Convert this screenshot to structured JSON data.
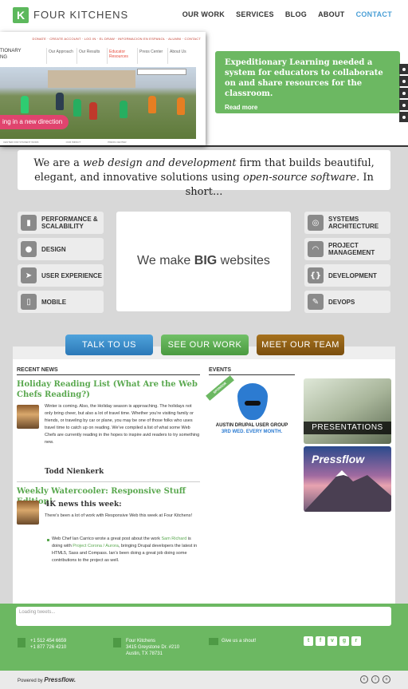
{
  "header": {
    "logo_letter": "K",
    "logo_text": "FOUR KITCHENS",
    "nav": [
      "OUR WORK",
      "SERVICES",
      "BLOG",
      "ABOUT",
      "CONTACT"
    ]
  },
  "hero": {
    "shot_toplinks": "DONATE · CREATE ACCOUNT · LOG IN · EL DRAW · INFORMACION EN ESPANOL · ALUMNI · CONTACT",
    "shot_logo": "TIONARY\nNG",
    "shot_nav": [
      "Our Approach",
      "Our Results",
      "Educator Resources",
      "Press Center",
      "About Us"
    ],
    "shot_banner": "ing in a new direction",
    "shot_foot": [
      "CENTER FOR STUDENT WORK",
      "OUR IMPACT",
      "PRESS CENTER"
    ],
    "promo_text": "Expeditionary Learning needed a system for educators to collaborate on and share resources for the classroom.",
    "promo_more": "Read more"
  },
  "tagline": {
    "part1": "We are a ",
    "em1": "web design and development",
    "part2": " firm that builds beautiful, elegant, and innovative solutions using ",
    "em2": "open-source software.",
    "part3": " In short..."
  },
  "services_left": [
    {
      "label": "PERFORMANCE & SCALABILITY",
      "icon": "bars-icon"
    },
    {
      "label": "DESIGN",
      "icon": "palette-icon"
    },
    {
      "label": "USER EXPERIENCE",
      "icon": "cursor-icon"
    },
    {
      "label": "MOBILE",
      "icon": "mobile-icon"
    }
  ],
  "services_right": [
    {
      "label": "SYSTEMS ARCHITECTURE",
      "icon": "network-icon"
    },
    {
      "label": "PROJECT MANAGEMENT",
      "icon": "gauge-icon"
    },
    {
      "label": "DEVELOPMENT",
      "icon": "braces-icon"
    },
    {
      "label": "DEVOPS",
      "icon": "wrench-icon"
    }
  ],
  "big": {
    "prefix": "We make ",
    "strong": "BIG",
    "suffix": " websites"
  },
  "cta": [
    "TALK TO US",
    "SEE OUR WORK",
    "MEET OUR TEAM"
  ],
  "news": {
    "heading": "RECENT NEWS",
    "post1": {
      "title": "Holiday Reading List (What Are the Web Chefs Reading?)",
      "body": "Winter is coming. Also, the Holiday season is approaching. The holidays not only bring cheer, but also a lot of travel time. Whether you're visiting family or friends, or traveling by car or plane, you may be one of those folks who uses travel time to catch up on reading. We've compiled a list of what some Web Chefs are currently reading in the hopes to inspire avid readers to try something new.",
      "author": "Todd Nienkerk"
    },
    "post2": {
      "title": "Weekly Watercooler: Responsive Stuff Edition!",
      "subtitle": "4K news this week:",
      "body": "There's been a lot of work with Responsive Web this week at Four Kitchens!",
      "bullet_a": "Web Chef Ian Carrico wrote a great post about the work ",
      "bullet_link1": "Sam Richard",
      "bullet_b": " is doing with ",
      "bullet_link2": "Project Corona / Aurora",
      "bullet_c": ", bringing Drupal developers the latest in HTML5, Sass and Compass. Ian's been doing a great job doing some contributions to the project as well."
    }
  },
  "events": {
    "heading": "EVENTS",
    "sponsor": "SPONSOR",
    "title": "AUSTIN DRUPAL USER GROUP",
    "subtitle": "3RD WED. EVERY MONTH."
  },
  "side": {
    "presentations": "PRESENTATIONS",
    "pressflow": "Pressflow"
  },
  "footer": {
    "tweets_placeholder": "Loading tweets...",
    "phone1": "+1 512 454 6659",
    "phone2": "+1 877 726 4210",
    "addr1": "Four Kitchens",
    "addr2": "3415 Greystone Dr. #210",
    "addr3": "Austin, TX 78731",
    "shout": "Give us a shout!",
    "social": [
      "t",
      "f",
      "v",
      "g",
      "r"
    ],
    "powered_prefix": "Powered by ",
    "powered_brand": "Pressflow."
  },
  "colors": {
    "green": "#6cb862",
    "blue": "#4a9fd6",
    "brown": "#8a5a14"
  }
}
